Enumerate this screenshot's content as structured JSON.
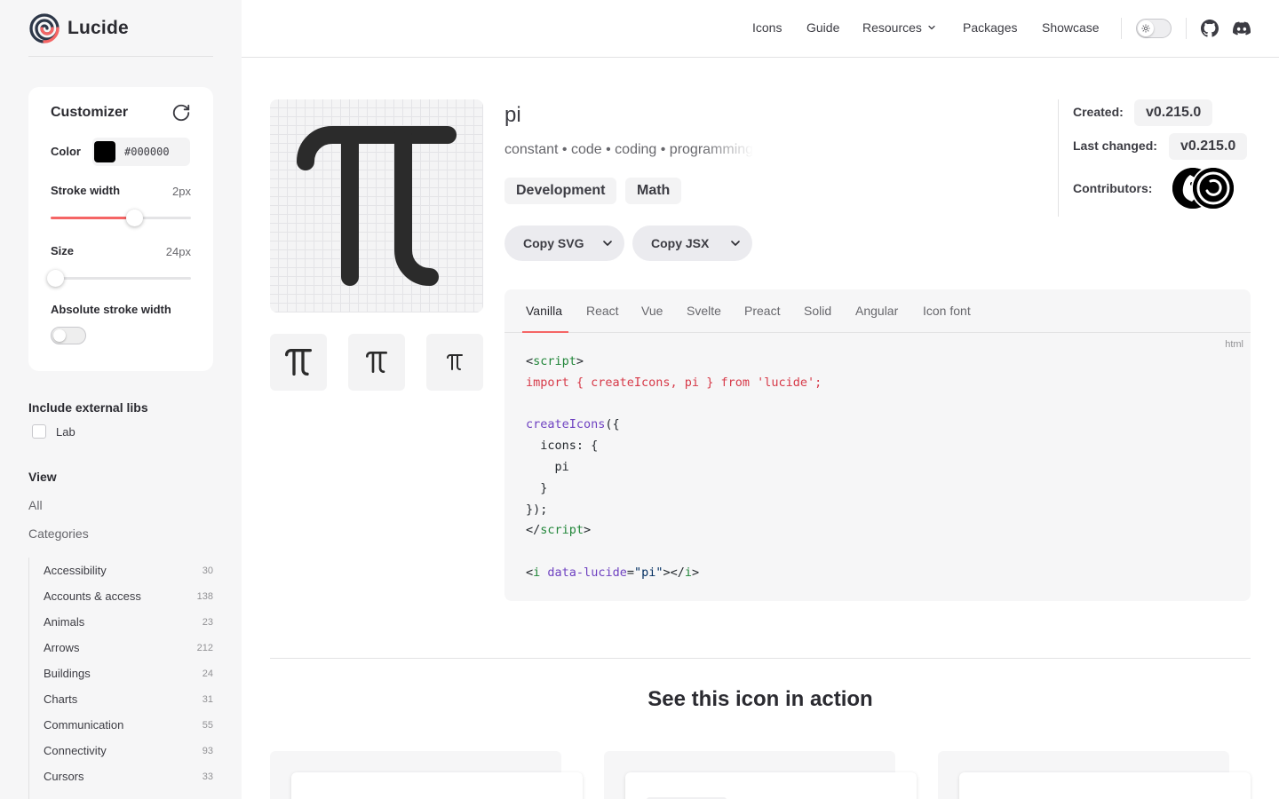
{
  "brand": {
    "name": "Lucide"
  },
  "nav": {
    "items": [
      "Icons",
      "Guide",
      "Resources",
      "Packages",
      "Showcase"
    ],
    "icons": [
      "sun-icon",
      "github-icon",
      "discord-icon"
    ]
  },
  "customizer": {
    "title": "Customizer",
    "color_label": "Color",
    "color_value": "#000000",
    "stroke_label": "Stroke width",
    "stroke_value": "2px",
    "stroke_level": 0.6,
    "size_label": "Size",
    "size_value": "24px",
    "size_level": 0.0,
    "absolute_label": "Absolute stroke width",
    "absolute_on": false
  },
  "external": {
    "title": "Include external libs",
    "lab_label": "Lab"
  },
  "view": {
    "title": "View",
    "all": "All",
    "categories": "Categories"
  },
  "categories": [
    {
      "name": "Accessibility",
      "count": "30"
    },
    {
      "name": "Accounts & access",
      "count": "138"
    },
    {
      "name": "Animals",
      "count": "23"
    },
    {
      "name": "Arrows",
      "count": "212"
    },
    {
      "name": "Buildings",
      "count": "24"
    },
    {
      "name": "Charts",
      "count": "31"
    },
    {
      "name": "Communication",
      "count": "55"
    },
    {
      "name": "Connectivity",
      "count": "93"
    },
    {
      "name": "Cursors",
      "count": "33"
    },
    {
      "name": "",
      "count": ""
    }
  ],
  "icon": {
    "name": "pi",
    "tags": "constant • code • coding • programming",
    "categories": [
      "Development",
      "Math"
    ],
    "copy_svg": "Copy SVG",
    "copy_jsx": "Copy JSX"
  },
  "meta": {
    "created_label": "Created:",
    "created_value": "v0.215.0",
    "changed_label": "Last changed:",
    "changed_value": "v0.215.0",
    "contributors_label": "Contributors:"
  },
  "code": {
    "tabs": [
      "Vanilla",
      "React",
      "Vue",
      "Svelte",
      "Preact",
      "Solid",
      "Angular",
      "Icon font"
    ],
    "active_tab": "Vanilla",
    "lang": "html",
    "lines": {
      "l1_open": "<",
      "l1_tag": "script",
      "l1_close": ">",
      "l2": "import { createIcons, pi } from 'lucide';",
      "l4_fn": "createIcons",
      "l4_rest": "({",
      "l5": "  icons: {",
      "l6": "    pi",
      "l7": "  }",
      "l8": "});",
      "l9_open": "</",
      "l9_tag": "script",
      "l9_close": ">",
      "l11_open": "<",
      "l11_tag": "i",
      "l11_attr": "data-lucide",
      "l11_eq": "=",
      "l11_str": "\"pi\"",
      "l11_mid": "></",
      "l11_tag2": "i",
      "l11_end": ">"
    }
  },
  "section": {
    "title": "See this icon in action"
  },
  "colors": {
    "accent": "#f56565",
    "sidebar_bg": "#f6f6f7",
    "text": "#3c3c43"
  }
}
